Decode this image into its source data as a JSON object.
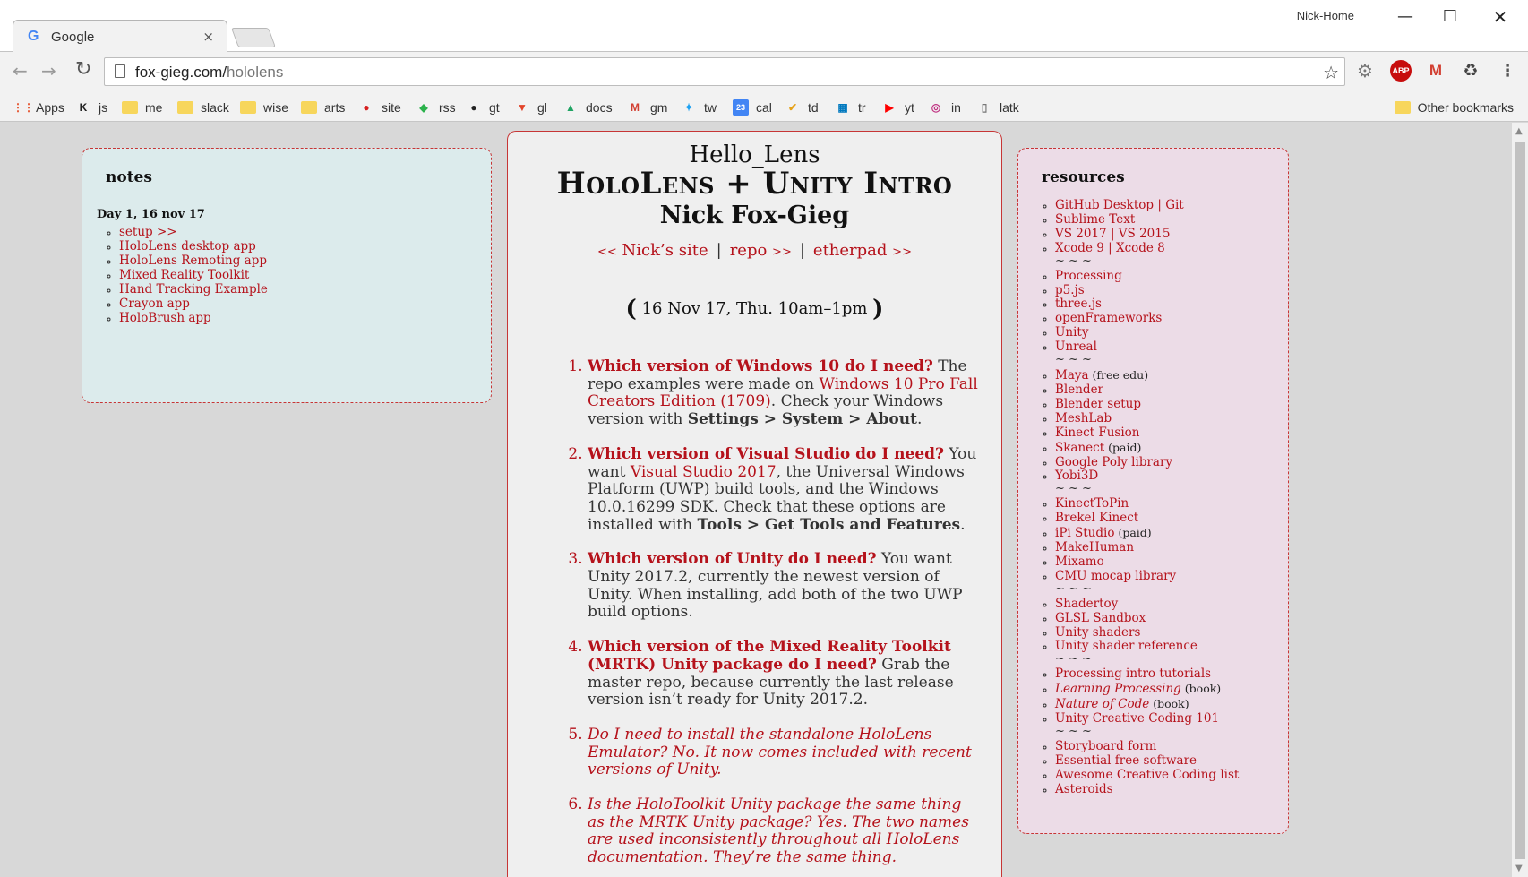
{
  "browser": {
    "tab_title": "Google",
    "tab_favicon": "G",
    "tab_close": "×",
    "profile_name": "Nick-Home",
    "window_buttons": {
      "minimize": "—",
      "maximize": "☐",
      "close": "✕"
    },
    "nav": {
      "back": "←",
      "forward": "→",
      "reload": "↻"
    },
    "url_host": "fox-gieg.com/",
    "url_path": "hololens",
    "star": "☆",
    "extensions": {
      "ext1": "⚙",
      "abp": "ABP",
      "gmail": "M",
      "recycle": "♻",
      "menu": "⋮"
    },
    "bookmarks": [
      {
        "label": "Apps",
        "icon": "apps-grid-icon",
        "glyph": "⋮⋮",
        "color": "#e44d26"
      },
      {
        "label": "js",
        "icon": "k-logo-icon",
        "glyph": "K",
        "color": "#222222"
      },
      {
        "label": "me",
        "icon": "folder-icon",
        "glyph": "",
        "color": "#f7d65c"
      },
      {
        "label": "slack",
        "icon": "folder-icon",
        "glyph": "",
        "color": "#f7d65c"
      },
      {
        "label": "wise",
        "icon": "folder-icon",
        "glyph": "",
        "color": "#f7d65c"
      },
      {
        "label": "arts",
        "icon": "folder-icon",
        "glyph": "",
        "color": "#f7d65c"
      },
      {
        "label": "site",
        "icon": "site-logo-icon",
        "glyph": "●",
        "color": "#d62020"
      },
      {
        "label": "rss",
        "icon": "feedly-icon",
        "glyph": "◆",
        "color": "#2bb24c"
      },
      {
        "label": "gt",
        "icon": "github-icon",
        "glyph": "●",
        "color": "#222222"
      },
      {
        "label": "gl",
        "icon": "gitlab-icon",
        "glyph": "▼",
        "color": "#e24329"
      },
      {
        "label": "docs",
        "icon": "drive-icon",
        "glyph": "▲",
        "color": "#1fa463"
      },
      {
        "label": "gm",
        "icon": "gmail-icon",
        "glyph": "M",
        "color": "#d23f31"
      },
      {
        "label": "tw",
        "icon": "twitter-icon",
        "glyph": "✦",
        "color": "#1da1f2"
      },
      {
        "label": "cal",
        "icon": "calendar-icon",
        "glyph": "23",
        "color": "#4285f4"
      },
      {
        "label": "td",
        "icon": "todoist-check-icon",
        "glyph": "✔",
        "color": "#e6a21a"
      },
      {
        "label": "tr",
        "icon": "trello-icon",
        "glyph": "▦",
        "color": "#0079bf"
      },
      {
        "label": "yt",
        "icon": "youtube-icon",
        "glyph": "▶",
        "color": "#ff0000"
      },
      {
        "label": "in",
        "icon": "instagram-icon",
        "glyph": "◎",
        "color": "#c13584"
      },
      {
        "label": "latk",
        "icon": "document-icon",
        "glyph": "▯",
        "color": "#777777"
      }
    ],
    "other_bookmarks": "Other bookmarks"
  },
  "notes": {
    "heading": "notes",
    "day": "Day 1, 16 nov 17",
    "items": [
      "setup >>",
      "HoloLens desktop app",
      "HoloLens Remoting app",
      "Mixed Reality Toolkit",
      "Hand Tracking Example",
      "Crayon app",
      "HoloBrush app"
    ]
  },
  "center": {
    "hello": "Hello_Lens",
    "title": "HoloLens + Unity Intro",
    "author": "Nick Fox-Gieg",
    "links": {
      "site_prefix": "<<",
      "site": "Nick’s site",
      "divider": "|",
      "repo": "repo",
      "repo_suffix": ">>",
      "etherpad": "etherpad",
      "etherpad_suffix": ">>"
    },
    "date": "16 Nov 17, Thu.  10am–1pm",
    "date_open": "(",
    "date_close": ")",
    "faq": [
      {
        "q": "Which version of Windows 10 do I need?",
        "a1": " The repo examples were made on ",
        "link": "Windows 10 Pro Fall Creators Edition (1709)",
        "a2": ". Check your Windows version with ",
        "bold": "Settings > System > About",
        "a3": "."
      },
      {
        "q": "Which version of Visual Studio do I need?",
        "a1": " You want ",
        "link": "Visual Studio 2017",
        "a2": ", the Universal Windows Platform (UWP) build tools, and the Windows 10.0.16299 SDK. Check that these options are installed with ",
        "bold": "Tools > Get Tools and Features",
        "a3": "."
      },
      {
        "q": "Which version of Unity do I need?",
        "a1": " You want Unity 2017.2, currently the newest version of Unity. When installing, add both of the two UWP build options."
      },
      {
        "q_pre": "Which version of the ",
        "q_link": "Mixed Reality Toolkit",
        "q_post": " (MRTK) Unity package do I need?",
        "a1": " Grab the master repo, because currently the last release version isn’t ready for Unity 2017.2."
      },
      {
        "em": "Do I need to install the standalone HoloLens Emulator? No. It now comes included with recent versions of Unity."
      },
      {
        "em": "Is the HoloToolkit Unity package the same thing as the MRTK Unity package? Yes. The two names are used inconsistently throughout all HoloLens documentation. They’re the same thing."
      }
    ]
  },
  "resources": {
    "heading": "resources",
    "separator": "~ ~ ~",
    "groups": [
      [
        {
          "label": "GitHub Desktop",
          "extra_link": "Git",
          "joiner": " | "
        },
        {
          "label": "Sublime Text"
        },
        {
          "label": "VS 2017",
          "extra_link": "VS 2015",
          "joiner": " | "
        },
        {
          "label": "Xcode 9",
          "extra_link": "Xcode 8",
          "joiner": " | "
        }
      ],
      [
        {
          "label": "Processing"
        },
        {
          "label": "p5.js"
        },
        {
          "label": "three.js"
        },
        {
          "label": "openFrameworks"
        },
        {
          "label": "Unity"
        },
        {
          "label": "Unreal"
        }
      ],
      [
        {
          "label": "Maya",
          "note": " (free edu)"
        },
        {
          "label": "Blender"
        },
        {
          "label": "Blender setup"
        },
        {
          "label": "MeshLab"
        },
        {
          "label": "Kinect Fusion"
        },
        {
          "label": "Skanect",
          "note": " (paid)"
        },
        {
          "label": "Google Poly library"
        },
        {
          "label": "Yobi3D"
        }
      ],
      [
        {
          "label": "KinectToPin"
        },
        {
          "label": "Brekel Kinect"
        },
        {
          "label": "iPi Studio",
          "note": " (paid)"
        },
        {
          "label": "MakeHuman"
        },
        {
          "label": "Mixamo"
        },
        {
          "label": "CMU mocap library"
        }
      ],
      [
        {
          "label": "Shadertoy"
        },
        {
          "label": "GLSL Sandbox"
        },
        {
          "label": "Unity shaders"
        },
        {
          "label": "Unity shader reference"
        }
      ],
      [
        {
          "label": "Processing intro tutorials"
        },
        {
          "label": "Learning Processing",
          "italic": true,
          "note": " (book)"
        },
        {
          "label": "Nature of Code",
          "italic": true,
          "note": " (book)"
        },
        {
          "label": "Unity Creative Coding 101"
        }
      ],
      [
        {
          "label": "Storyboard form"
        },
        {
          "label": "Essential free software"
        },
        {
          "label": "Awesome Creative Coding list"
        },
        {
          "label": "Asteroids"
        }
      ]
    ]
  }
}
